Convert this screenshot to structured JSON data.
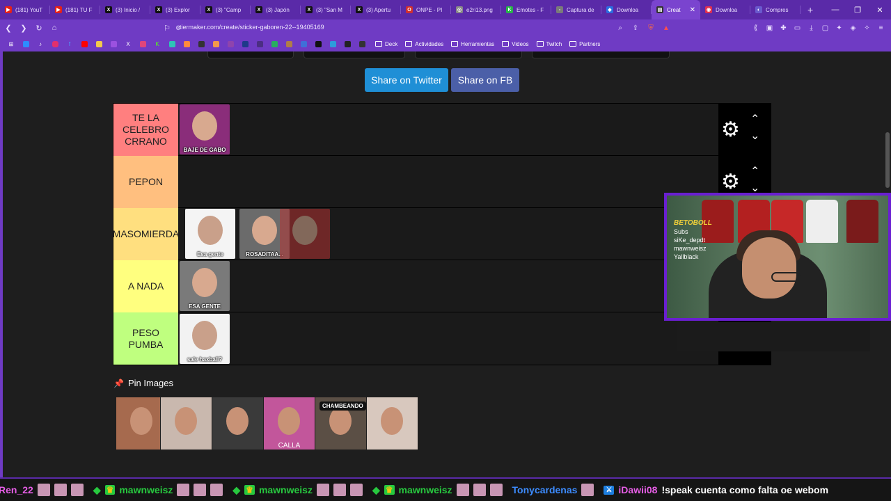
{
  "browser": {
    "tabs": [
      {
        "label": "(181) YouT",
        "color": "#e62117",
        "glyph": "▶"
      },
      {
        "label": "(181) TU F",
        "color": "#e62117",
        "glyph": "▶"
      },
      {
        "label": "(3) Inicio /",
        "color": "#111111",
        "glyph": "X"
      },
      {
        "label": "(3) Explor",
        "color": "#111111",
        "glyph": "X"
      },
      {
        "label": "(3) \"Camp",
        "color": "#111111",
        "glyph": "X"
      },
      {
        "label": "(3) Japón",
        "color": "#111111",
        "glyph": "X"
      },
      {
        "label": "(3) \"San M",
        "color": "#111111",
        "glyph": "X"
      },
      {
        "label": "(3) Apertu",
        "color": "#111111",
        "glyph": "X"
      },
      {
        "label": "ONPE - PI",
        "color": "#d0302f",
        "glyph": "O"
      },
      {
        "label": "e2ri13.png",
        "color": "#888888",
        "glyph": "◎"
      },
      {
        "label": "Emotes - F",
        "color": "#29b34a",
        "glyph": "K"
      },
      {
        "label": "Captura de",
        "color": "#7a7a7a",
        "glyph": "▫"
      },
      {
        "label": "Downloa",
        "color": "#2b6ee0",
        "glyph": "◆"
      }
    ],
    "active_tab": {
      "label": "Creat",
      "color": "#333333",
      "glyph": "▤"
    },
    "tabs_after": [
      {
        "label": "Downloa",
        "color": "#e0304f",
        "glyph": "◉"
      },
      {
        "label": "Compres",
        "color": "#6a5acd",
        "glyph": "◐"
      }
    ],
    "url": "tiermaker.com/create/sticker-gaboren-22--19405169",
    "bookmarks": [
      {
        "label": "Deck"
      },
      {
        "label": "Actividades"
      },
      {
        "label": "Herramientas"
      },
      {
        "label": "Videos"
      },
      {
        "label": "Twitch"
      },
      {
        "label": "Partners"
      }
    ]
  },
  "share": {
    "twitter": "Share on Twitter",
    "facebook": "Share on FB"
  },
  "tiers": [
    {
      "label": "TE LA CELEBRO CRRANO",
      "color": "#ff7f7f",
      "items": [
        {
          "caption": "BAJE DE GABO",
          "bg": "#8a2d7a"
        }
      ]
    },
    {
      "label": "PEPON",
      "color": "#ffbf7f",
      "items": []
    },
    {
      "label": "MASOMIERDA",
      "color": "#ffdf7f",
      "items": [
        {
          "caption": "Esa gente",
          "bg": "#f4f4f4"
        },
        {
          "caption": "ROSADITAA...",
          "bg": "#6b6b6b"
        },
        {
          "caption": "",
          "bg": "#b43333"
        }
      ]
    },
    {
      "label": "A NADA",
      "color": "#ffff7f",
      "items": [
        {
          "caption": "ESA GENTE",
          "bg": "#7a7a7a"
        }
      ]
    },
    {
      "label": "PESO PUMBA",
      "color": "#bfff7f",
      "items": [
        {
          "caption": "sale haxball?",
          "bg": "#f2f2f2"
        }
      ]
    }
  ],
  "pin": {
    "title": "Pin Images",
    "images": [
      {
        "tag": "",
        "caption": "",
        "bg": "#a66a4e"
      },
      {
        "tag": "",
        "caption": "",
        "bg": "#c9b8ae"
      },
      {
        "tag": "",
        "caption": "",
        "bg": "#3a3a3a"
      },
      {
        "tag": "",
        "caption": "CALLA",
        "bg": "#c2569b"
      },
      {
        "tag": "CHAMBEANDO",
        "caption": "",
        "bg": "#5b4f45"
      },
      {
        "tag": "",
        "caption": "",
        "bg": "#d8c8be"
      }
    ]
  },
  "webcam": {
    "brand": "BETOBOLL",
    "lines": [
      "Subs",
      "siKe_depdt",
      "mawnweisz",
      "Yallblack"
    ]
  },
  "chat": [
    {
      "user": "Ren_22",
      "color": "#e75ee7",
      "text": "",
      "badge": "none"
    },
    {
      "user": "mawnweisz",
      "color": "#27c93f",
      "text": "",
      "badge": "crown"
    },
    {
      "user": "mawnweisz",
      "color": "#27c93f",
      "text": "",
      "badge": "crown"
    },
    {
      "user": "mawnweisz",
      "color": "#27c93f",
      "text": "",
      "badge": "crown"
    },
    {
      "user": "Tonycardenas",
      "color": "#3d8cff",
      "text": "",
      "badge": "none"
    },
    {
      "user": "iDawii08",
      "color": "#e75ee7",
      "text": "!speak cuenta como falta oe webom",
      "badge": "sword"
    }
  ]
}
